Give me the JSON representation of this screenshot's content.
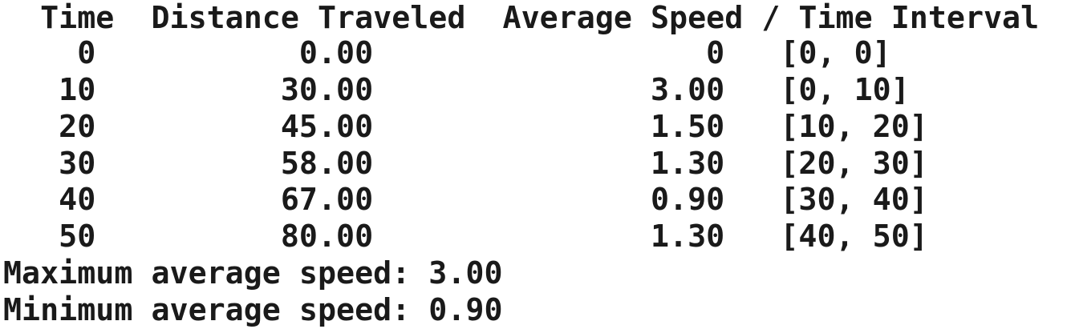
{
  "output": {
    "header": "  Time  Distance Traveled  Average Speed / Time Interval",
    "rows": [
      "    0           0.00                  0   [0, 0]",
      "   10          30.00               3.00   [0, 10]",
      "   20          45.00               1.50   [10, 20]",
      "   30          58.00               1.30   [20, 30]",
      "   40          67.00               0.90   [30, 40]",
      "   50          80.00               1.30   [40, 50]"
    ],
    "max_line": "Maximum average speed: 3.00",
    "min_line": "Minimum average speed: 0.90"
  }
}
